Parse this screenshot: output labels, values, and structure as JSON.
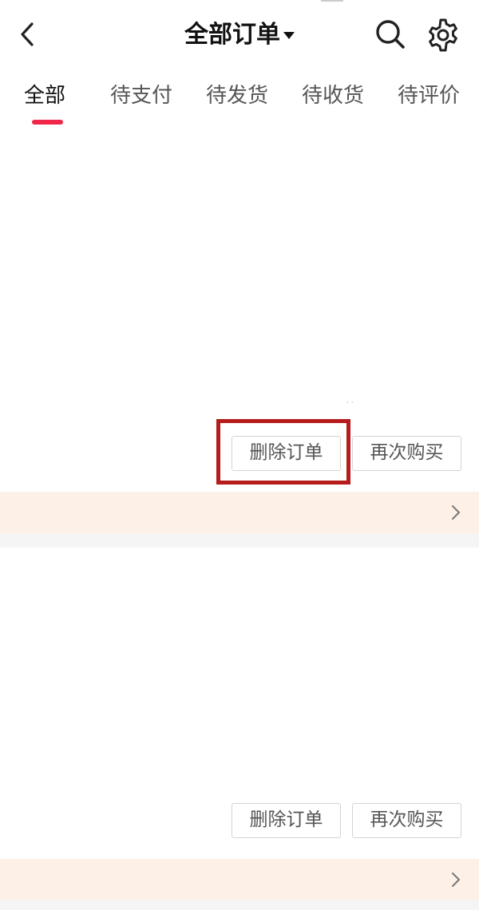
{
  "header": {
    "title": "全部订单",
    "back_icon": "chevron-left-icon",
    "search_icon": "search-icon",
    "settings_icon": "gear-icon"
  },
  "tabs": [
    {
      "label": "全部",
      "active": true
    },
    {
      "label": "待支付",
      "active": false
    },
    {
      "label": "待发货",
      "active": false
    },
    {
      "label": "待收货",
      "active": false
    },
    {
      "label": "待评价",
      "active": false
    }
  ],
  "orders": [
    {
      "delete_label": "删除订单",
      "rebuy_label": "再次购买",
      "highlighted": true
    },
    {
      "delete_label": "删除订单",
      "rebuy_label": "再次购买",
      "highlighted": false
    }
  ],
  "colors": {
    "accent": "#f0264a",
    "highlight_border": "#b71c1c",
    "promo_background": "#fdf0e6"
  }
}
